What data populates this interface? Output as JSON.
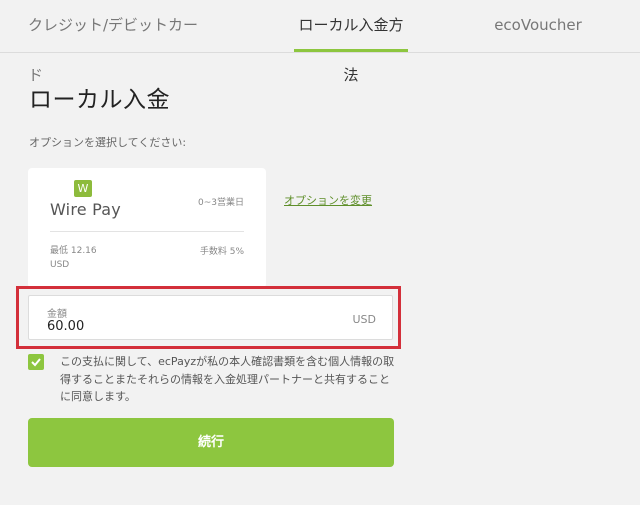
{
  "tabs": [
    {
      "label": "クレジット/デビットカード"
    },
    {
      "label": "ローカル入金方法"
    },
    {
      "label": "ecoVoucher"
    }
  ],
  "page": {
    "title": "ローカル入金",
    "subtitle": "オプションを選択してください:"
  },
  "option_card": {
    "logo_letter": "W",
    "logo_text": "Wire Pay",
    "processing_time": "0~3営業日",
    "minimum_label": "最低 12.16",
    "minimum_currency": "USD",
    "fee": "手数料 5%"
  },
  "change_option_link": "オプションを変更",
  "amount": {
    "label": "金額",
    "value": "60.00",
    "currency": "USD"
  },
  "consent": {
    "checked": true,
    "text": "この支払に関して、ecPayzが私の本人確認書類を含む個人情報の取得することまたそれらの情報を入金処理パートナーと共有することに同意します。"
  },
  "continue_button": "続行",
  "colors": {
    "accent": "#8dc63f",
    "highlight": "#d32f3a",
    "link": "#5f8f2a"
  }
}
